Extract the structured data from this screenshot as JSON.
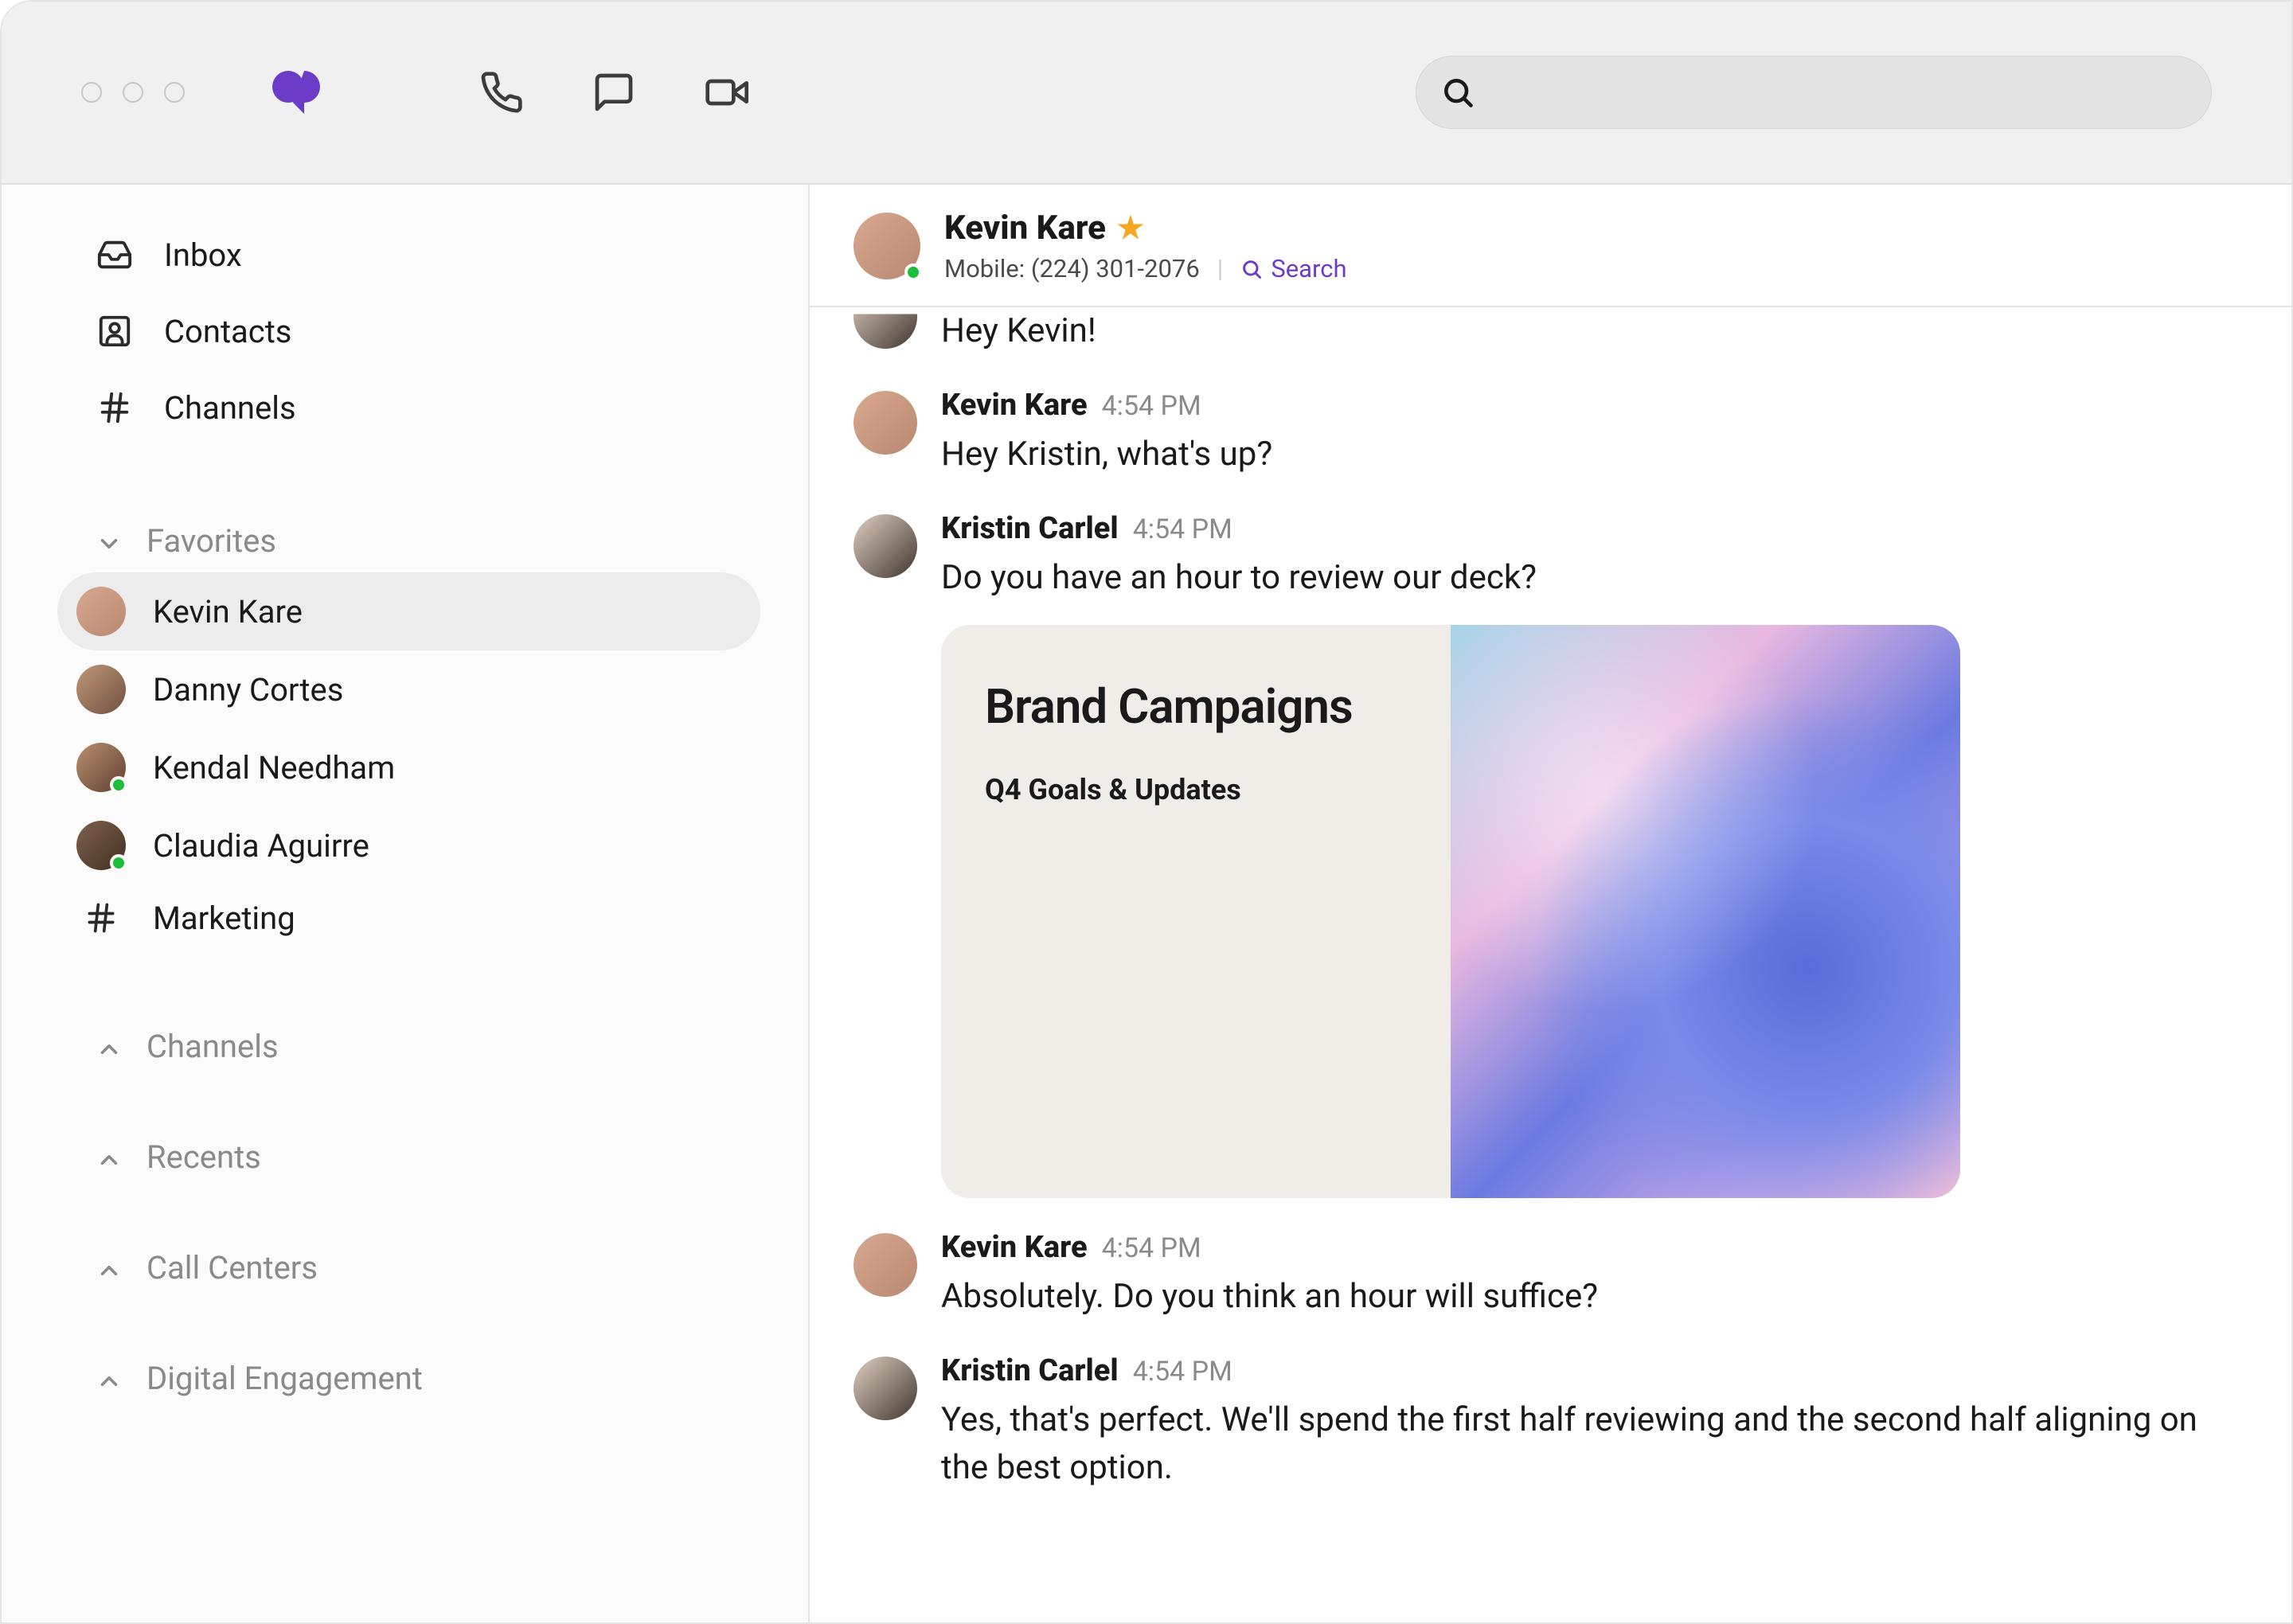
{
  "sidebar": {
    "nav": [
      {
        "label": "Inbox",
        "icon": "inbox"
      },
      {
        "label": "Contacts",
        "icon": "contacts"
      },
      {
        "label": "Channels",
        "icon": "hash"
      }
    ],
    "favorites_label": "Favorites",
    "favorites": [
      {
        "label": "Kevin Kare",
        "active": true
      },
      {
        "label": "Danny Cortes"
      },
      {
        "label": "Kendal Needham",
        "presence": true
      },
      {
        "label": "Claudia Aguirre",
        "presence": true
      },
      {
        "label": "Marketing",
        "icon": "hash"
      }
    ],
    "collapsed_sections": [
      "Channels",
      "Recents",
      "Call Centers",
      "Digital Engagement"
    ]
  },
  "conversation": {
    "title": "Kevin Kare",
    "mobile_label": "Mobile: (224) 301-2076",
    "search_label": "Search",
    "partial_first_msg": "Hey Kevin!",
    "messages": [
      {
        "author": "Kevin Kare",
        "time": "4:54 PM",
        "body": "Hey Kristin, what's up?",
        "avatar": "kevin"
      },
      {
        "author": "Kristin Carlel",
        "time": "4:54 PM",
        "body": "Do you have an hour to review our deck?",
        "avatar": "kristin",
        "attachment": {
          "title": "Brand Campaigns",
          "subtitle": "Q4 Goals & Updates"
        }
      },
      {
        "author": "Kevin Kare",
        "time": "4:54 PM",
        "body": "Absolutely. Do you think an hour will suffice?",
        "avatar": "kevin"
      },
      {
        "author": "Kristin Carlel",
        "time": "4:54 PM",
        "body": "Yes, that's perfect. We'll spend the first half reviewing and the second half aligning on the best option.",
        "avatar": "kristin"
      }
    ]
  }
}
